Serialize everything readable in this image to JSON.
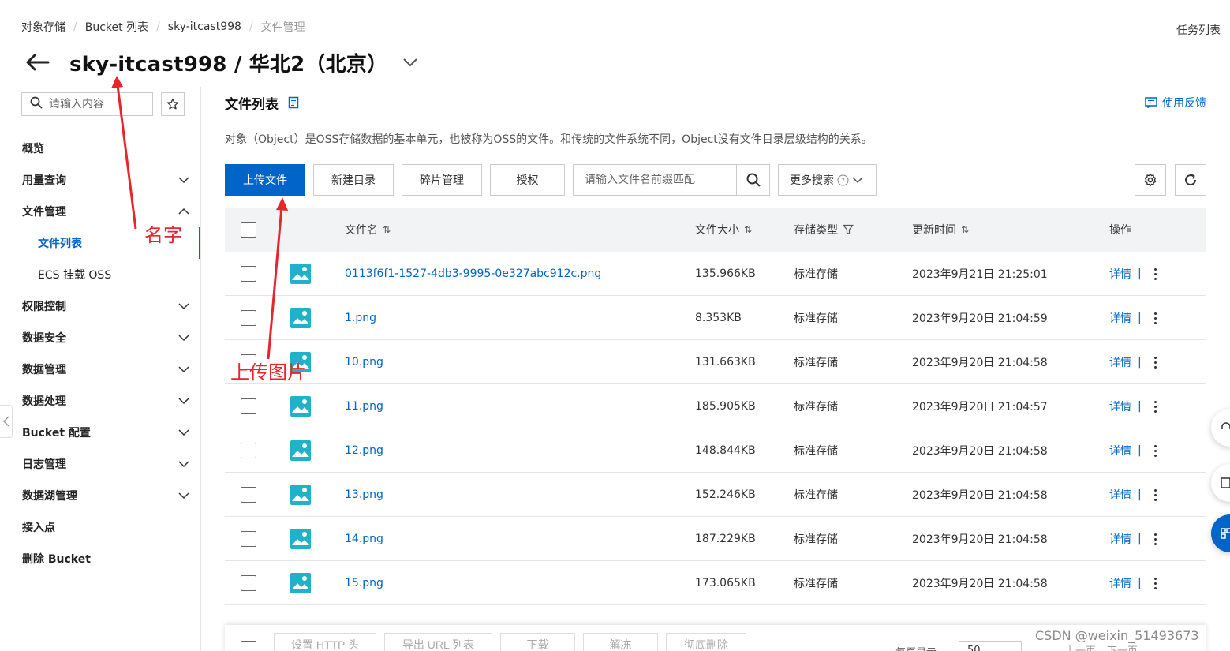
{
  "breadcrumb": [
    "对象存储",
    "Bucket 列表",
    "sky-itcast998",
    "文件管理"
  ],
  "task_list": "任务列表",
  "title": "sky-itcast998 / 华北2（北京）",
  "sidebar": {
    "search_placeholder": "请输入内容",
    "items": [
      {
        "label": "概览",
        "chevron": "none",
        "level": 1,
        "active": false
      },
      {
        "label": "用量查询",
        "chevron": "down",
        "level": 1,
        "active": false
      },
      {
        "label": "文件管理",
        "chevron": "up",
        "level": 1,
        "active": false
      },
      {
        "label": "文件列表",
        "chevron": "none",
        "level": 2,
        "active": true
      },
      {
        "label": "ECS 挂载 OSS",
        "chevron": "none",
        "level": 2,
        "active": false
      },
      {
        "label": "权限控制",
        "chevron": "down",
        "level": 1,
        "active": false
      },
      {
        "label": "数据安全",
        "chevron": "down",
        "level": 1,
        "active": false
      },
      {
        "label": "数据管理",
        "chevron": "down",
        "level": 1,
        "active": false
      },
      {
        "label": "数据处理",
        "chevron": "down",
        "level": 1,
        "active": false
      },
      {
        "label": "Bucket 配置",
        "chevron": "down",
        "level": 1,
        "active": false
      },
      {
        "label": "日志管理",
        "chevron": "down",
        "level": 1,
        "active": false
      },
      {
        "label": "数据湖管理",
        "chevron": "down",
        "level": 1,
        "active": false
      },
      {
        "label": "接入点",
        "chevron": "none",
        "level": 1,
        "active": false
      },
      {
        "label": "删除 Bucket",
        "chevron": "none",
        "level": 1,
        "active": false
      }
    ]
  },
  "main": {
    "title": "文件列表",
    "feedback": "使用反馈",
    "description": "对象（Object）是OSS存储数据的基本单元，也被称为OSS的文件。和传统的文件系统不同，Object没有文件目录层级结构的关系。",
    "toolbar": {
      "upload": "上传文件",
      "new_dir": "新建目录",
      "fragments": "碎片管理",
      "authorize": "授权",
      "search_placeholder": "请输入文件名前缀匹配",
      "more_search": "更多搜索"
    },
    "columns": {
      "name": "文件名",
      "size": "文件大小",
      "storage": "存储类型",
      "updated": "更新时间",
      "action": "操作"
    },
    "rows": [
      {
        "name": "0113f6f1-1527-4db3-9995-0e327abc912c.png",
        "size": "135.966KB",
        "storage": "标准存储",
        "updated": "2023年9月21日 21:25:01",
        "action": "详情"
      },
      {
        "name": "1.png",
        "size": "8.353KB",
        "storage": "标准存储",
        "updated": "2023年9月20日 21:04:59",
        "action": "详情"
      },
      {
        "name": "10.png",
        "size": "131.663KB",
        "storage": "标准存储",
        "updated": "2023年9月20日 21:04:58",
        "action": "详情"
      },
      {
        "name": "11.png",
        "size": "185.905KB",
        "storage": "标准存储",
        "updated": "2023年9月20日 21:04:57",
        "action": "详情"
      },
      {
        "name": "12.png",
        "size": "148.844KB",
        "storage": "标准存储",
        "updated": "2023年9月20日 21:04:58",
        "action": "详情"
      },
      {
        "name": "13.png",
        "size": "152.246KB",
        "storage": "标准存储",
        "updated": "2023年9月20日 21:04:58",
        "action": "详情"
      },
      {
        "name": "14.png",
        "size": "187.229KB",
        "storage": "标准存储",
        "updated": "2023年9月20日 21:04:58",
        "action": "详情"
      },
      {
        "name": "15.png",
        "size": "173.065KB",
        "storage": "标准存储",
        "updated": "2023年9月20日 21:04:58",
        "action": "详情"
      }
    ],
    "bottom_bar": {
      "set_http_header": "设置 HTTP 头",
      "export_url": "导出 URL 列表",
      "download": "下载",
      "unfreeze": "解冻",
      "delete": "彻底删除",
      "per_page_label": "每页显示",
      "per_page_value": "50",
      "prev": "上一页",
      "next": "下一页"
    }
  },
  "annotations": {
    "name_label": "名字",
    "upload_label": "上传图片"
  },
  "watermark": "CSDN @weixin_51493673",
  "colors": {
    "accent": "#0064c8",
    "annotation": "#e8252a",
    "header_bg": "#f1f3f5"
  }
}
